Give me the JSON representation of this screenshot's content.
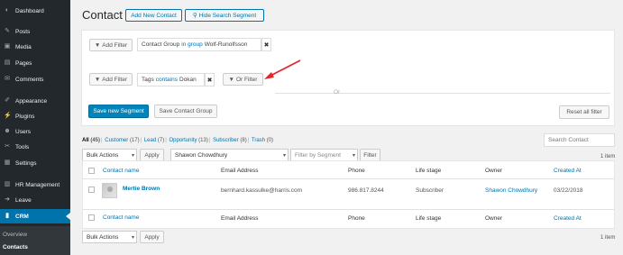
{
  "sidebar": {
    "items": [
      {
        "label": "Dashboard",
        "icon": "dashboard-icon",
        "glyph": "◐"
      },
      {
        "label": "Posts",
        "icon": "pin-icon",
        "glyph": "✎"
      },
      {
        "label": "Media",
        "icon": "media-icon",
        "glyph": "▣"
      },
      {
        "label": "Pages",
        "icon": "pages-icon",
        "glyph": "▤"
      },
      {
        "label": "Comments",
        "icon": "comments-icon",
        "glyph": "✉"
      },
      {
        "label": "Appearance",
        "icon": "brush-icon",
        "glyph": "✐"
      },
      {
        "label": "Plugins",
        "icon": "plug-icon",
        "glyph": "⚡"
      },
      {
        "label": "Users",
        "icon": "users-icon",
        "glyph": "☻"
      },
      {
        "label": "Tools",
        "icon": "wrench-icon",
        "glyph": "✂"
      },
      {
        "label": "Settings",
        "icon": "settings-icon",
        "glyph": "▦"
      },
      {
        "label": "HR Management",
        "icon": "hr-icon",
        "glyph": "▥"
      },
      {
        "label": "Leave",
        "icon": "leave-icon",
        "glyph": "➜"
      },
      {
        "label": "CRM",
        "icon": "crm-icon",
        "glyph": "▮"
      }
    ],
    "submenu": [
      "Overview",
      "Contacts"
    ]
  },
  "page": {
    "title": "Contact",
    "add_new": "Add New Contact",
    "hide_search": "Hide Search Segment"
  },
  "filters": {
    "add_filter": "Add Filter",
    "group1": {
      "field": "Contact Group",
      "operator": "in group",
      "value": "Wolf-Runolfsson"
    },
    "or_label": "Or",
    "group2": {
      "field": "Tags",
      "operator": "contains",
      "value": "Dokan"
    },
    "or_filter": "Or Filter",
    "remove": "✖",
    "save_segment": "Save new Segment",
    "save_group": "Save Contact Group",
    "reset": "Reset all filter"
  },
  "views": [
    {
      "label": "All",
      "count": "(45)",
      "current": true
    },
    {
      "label": "Customer",
      "count": "(17)"
    },
    {
      "label": "Lead",
      "count": "(7)"
    },
    {
      "label": "Opportunity",
      "count": "(13)"
    },
    {
      "label": "Subscriber",
      "count": "(8)"
    },
    {
      "label": "Trash",
      "count": "(0)"
    }
  ],
  "search_placeholder": "Search Contact",
  "item_count": "1 item",
  "toolbar": {
    "bulk_actions": "Bulk Actions",
    "apply": "Apply",
    "owner_filter": "Shawon Chowdhury",
    "segment_placeholder": "Filter by Segment",
    "filter": "Filter"
  },
  "table": {
    "columns": [
      "Contact name",
      "Email Address",
      "Phone",
      "Life stage",
      "Owner",
      "Created At"
    ],
    "rows": [
      {
        "name": "Mertie Brown",
        "email": "bernhard.kassulke@harris.com",
        "phone": "986.817.8244",
        "stage": "Subscriber",
        "owner": "Shawon Chowdhury",
        "created": "03/22/2018"
      }
    ]
  },
  "colors": {
    "accent": "#0073aa",
    "sidebar": "#23282d",
    "annotation_arrow": "#e2262a"
  }
}
